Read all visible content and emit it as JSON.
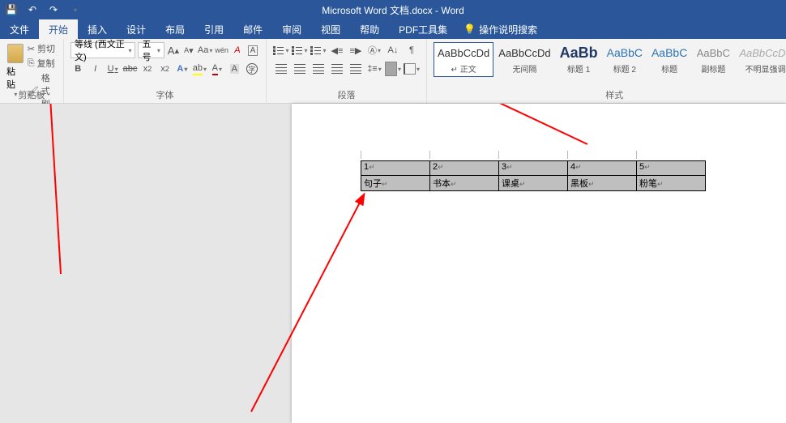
{
  "title": "Microsoft Word 文档.docx - Word",
  "menu": {
    "file": "文件",
    "home": "开始",
    "insert": "插入",
    "design": "设计",
    "layout": "布局",
    "references": "引用",
    "mailings": "邮件",
    "review": "审阅",
    "view": "视图",
    "help": "帮助",
    "pdf": "PDF工具集",
    "tellme": "操作说明搜索"
  },
  "clipboard": {
    "cut": "剪切",
    "copy": "复制",
    "paste": "粘贴",
    "formatpainter": "格式刷",
    "group": "剪贴板"
  },
  "font": {
    "name": "等线 (西文正文)",
    "size": "五号",
    "group": "字体",
    "clear": "A",
    "phonetic": "wén",
    "charborder": "A",
    "grow": "A",
    "shrink": "A",
    "changecase": "Aa"
  },
  "paragraph": {
    "group": "段落"
  },
  "styles": {
    "group": "样式",
    "items": [
      {
        "preview": "AaBbCcDd",
        "name": "正文",
        "selected": true,
        "class": ""
      },
      {
        "preview": "AaBbCcDd",
        "name": "无间隔",
        "selected": false,
        "class": ""
      },
      {
        "preview": "AaBb",
        "name": "标题 1",
        "selected": false,
        "class": "sp-big"
      },
      {
        "preview": "AaBbC",
        "name": "标题 2",
        "selected": false,
        "class": "sp-heading"
      },
      {
        "preview": "AaBbC",
        "name": "标题",
        "selected": false,
        "class": "sp-heading"
      },
      {
        "preview": "AaBbC",
        "name": "副标题",
        "selected": false,
        "class": "sp-sub"
      },
      {
        "preview": "AaBbCcDd",
        "name": "不明显强调",
        "selected": false,
        "class": "sp-dim"
      }
    ]
  },
  "table": {
    "row1": [
      "1",
      "2",
      "3",
      "4",
      "5"
    ],
    "row2": [
      "句子",
      "书本",
      "课桌",
      "黑板",
      "粉笔"
    ]
  }
}
